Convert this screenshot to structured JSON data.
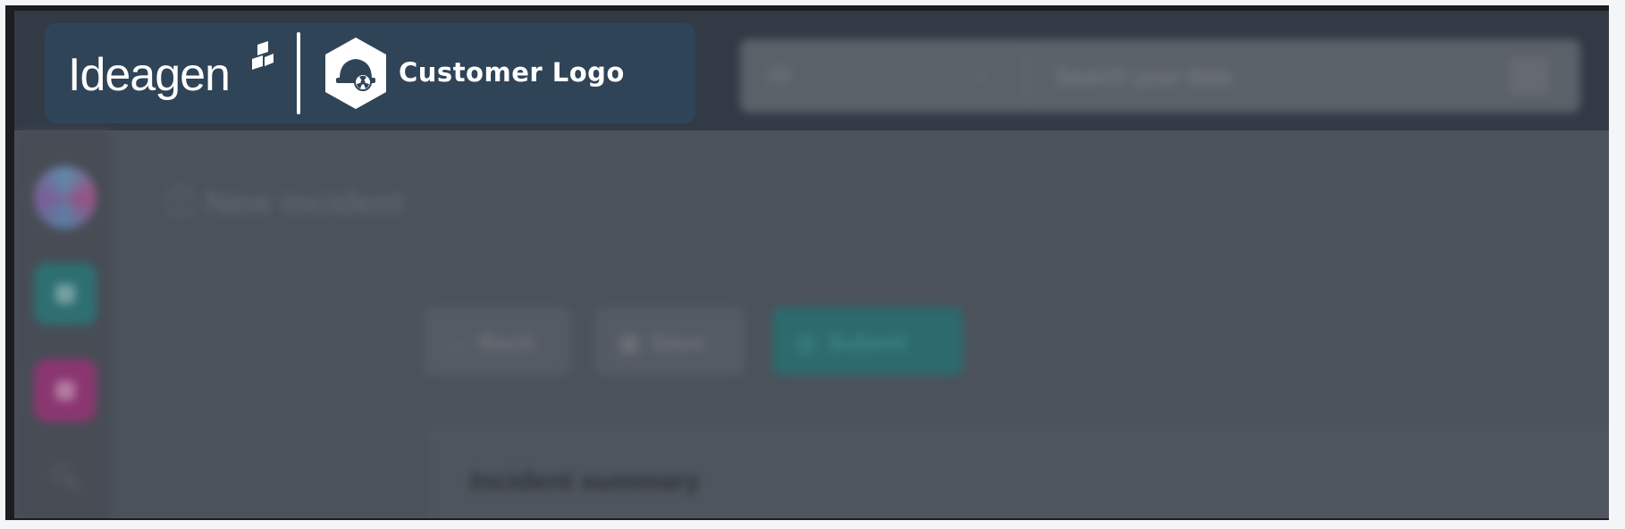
{
  "brand": {
    "wordmark": "Ideagen",
    "customer_label": "Customer Logo"
  },
  "search": {
    "scope_label": "All",
    "placeholder": "Search your data",
    "scope_icon": "chevron-down-icon",
    "submit_icon": "keyboard-shortcut-icon"
  },
  "sidebar": {
    "items": [
      {
        "icon": "avatar-icon",
        "color": "#9a4f83"
      },
      {
        "icon": "incidents-app-icon",
        "color": "#2e6f72"
      },
      {
        "icon": "home-app-icon",
        "color": "#8b3670"
      },
      {
        "icon": "search-icon"
      }
    ]
  },
  "page": {
    "title": "New incident",
    "title_icon": "info-icon"
  },
  "toolbar": {
    "back_label": "Back",
    "back_icon": "arrow-left-icon",
    "save_label": "Save",
    "save_icon": "save-icon",
    "submit_label": "Submit",
    "submit_icon": "check-circle-icon",
    "submit_color": "#2c6a6d"
  },
  "section": {
    "title": "Incident summary"
  },
  "colors": {
    "brand_panel": "#304458",
    "overlay": "#4c525b"
  }
}
